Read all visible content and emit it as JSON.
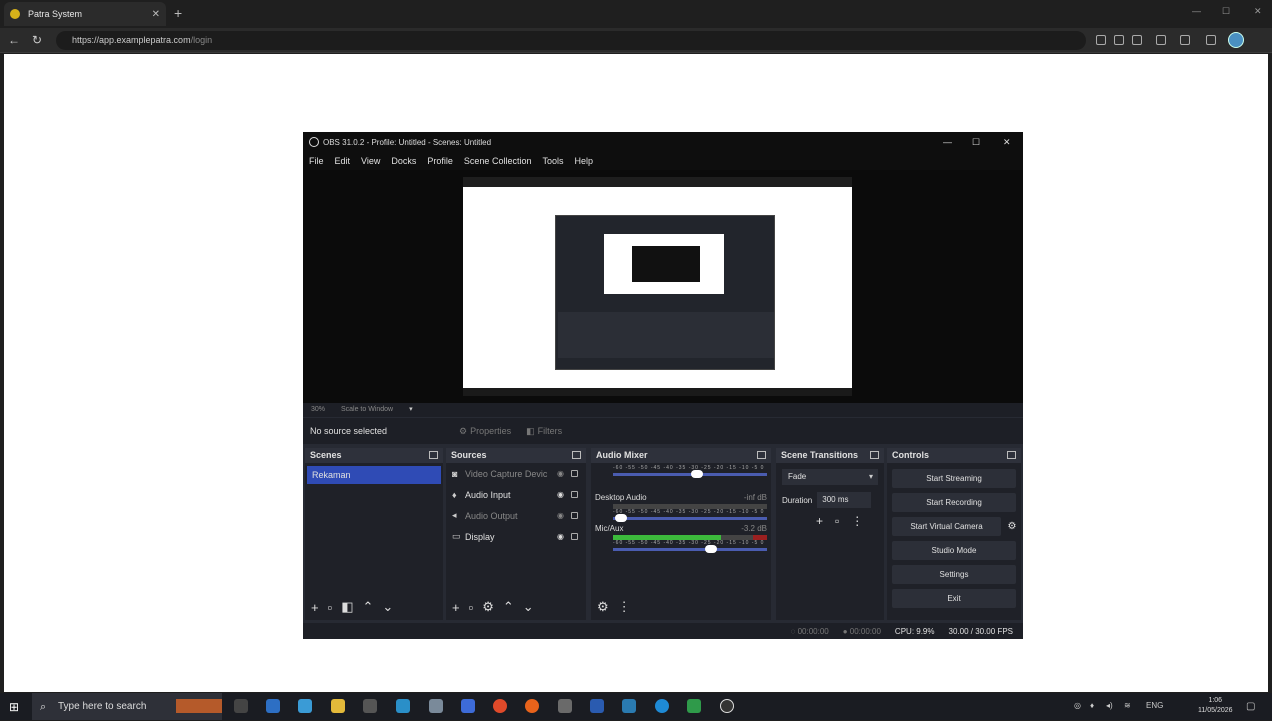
{
  "browser": {
    "tab_title": "Patra System",
    "url_domain": "https://app.examplepatra.com",
    "url_path": "/login"
  },
  "obs": {
    "title": "OBS 31.0.2 - Profile: Untitled - Scenes: Untitled",
    "menu": [
      "File",
      "Edit",
      "View",
      "Docks",
      "Profile",
      "Scene Collection",
      "Tools",
      "Help"
    ],
    "zoom_level": "30%",
    "zoom_mode": "Scale to Window",
    "no_source": "No source selected",
    "properties_label": "Properties",
    "filters_label": "Filters",
    "scenes": {
      "title": "Scenes",
      "items": [
        "Rekaman"
      ]
    },
    "sources": {
      "title": "Sources",
      "items": [
        {
          "label": "Video Capture Devic",
          "icon": "camera-icon",
          "hidden": true
        },
        {
          "label": "Audio Input",
          "icon": "microphone-icon",
          "hidden": false
        },
        {
          "label": "Audio Output",
          "icon": "speaker-icon",
          "hidden": true
        },
        {
          "label": "Display",
          "icon": "monitor-icon",
          "hidden": false
        }
      ]
    },
    "mixer": {
      "title": "Audio Mixer",
      "channels": [
        {
          "name": "Desktop Audio",
          "level": "-inf dB",
          "meter": 0.0,
          "volume": 0.15
        },
        {
          "name": "Mic/Aux",
          "level": "-3.2 dB",
          "meter": 0.7,
          "volume": 0.75
        }
      ],
      "scale": "-60 -55 -50 -45 -40 -35 -30 -25 -20 -15 -10 -5 0"
    },
    "transitions": {
      "title": "Scene Transitions",
      "selected": "Fade",
      "duration_label": "Duration",
      "duration_value": "300 ms"
    },
    "controls": {
      "title": "Controls",
      "buttons": [
        "Start Streaming",
        "Start Recording",
        "Start Virtual Camera",
        "Studio Mode",
        "Settings",
        "Exit"
      ]
    },
    "status": {
      "stream_time": "00:00:00",
      "rec_time": "00:00:00",
      "cpu": "CPU: 9.9%",
      "fps": "30.00 / 30.00 FPS"
    }
  },
  "taskbar": {
    "search_placeholder": "Type here to search",
    "lang": "ENG",
    "time": "1:06",
    "date": "11/05/2026"
  }
}
